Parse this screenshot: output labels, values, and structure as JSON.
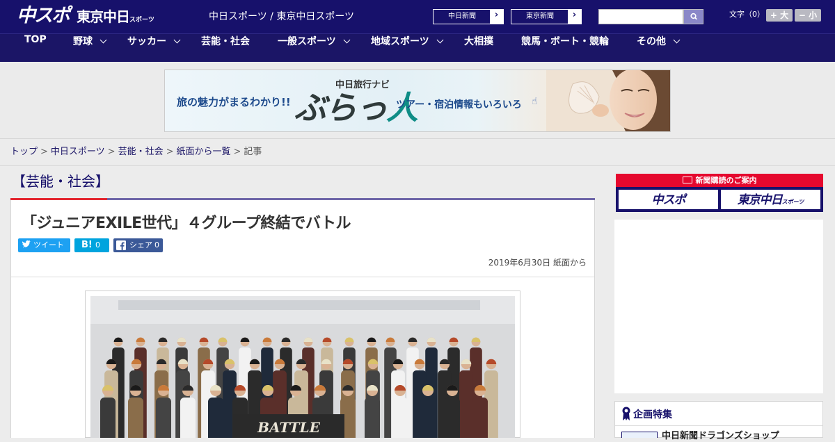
{
  "header": {
    "logo_chuspo": "中スポ",
    "logo_tokyo_main": "東京中日",
    "logo_tokyo_small": "スポーツ",
    "site_names": "中日スポーツ / 東京中日スポーツ",
    "paper_links": [
      "中日新聞",
      "東京新聞"
    ],
    "link_arrow": "›",
    "search_placeholder": "",
    "text_size_label": "文字（0）",
    "size_up_label": "+ 大",
    "size_down_label": "− 小"
  },
  "nav": {
    "items": [
      {
        "label": "TOP",
        "has_menu": false
      },
      {
        "label": "野球",
        "has_menu": true
      },
      {
        "label": "サッカー",
        "has_menu": true
      },
      {
        "label": "芸能・社会",
        "has_menu": false
      },
      {
        "label": "一般スポーツ",
        "has_menu": true
      },
      {
        "label": "地域スポーツ",
        "has_menu": true
      },
      {
        "label": "大相撲",
        "has_menu": false
      },
      {
        "label": "競馬・ボート・競輪",
        "has_menu": false
      },
      {
        "label": "その他",
        "has_menu": true
      }
    ]
  },
  "banner": {
    "catch": "旅の魅力がまるわかり!!",
    "kicker": "中日旅行ナビ",
    "title_main": "ぶらっ",
    "title_accent": "人",
    "sub": "ツアー・宿泊情報もいろいろ",
    "hand_icon": "☝"
  },
  "breadcrumb": {
    "items": [
      "トップ",
      "中日スポーツ",
      "芸能・社会",
      "紙面から一覧"
    ],
    "current": "記事",
    "separator": ">"
  },
  "article": {
    "category": "【芸能・社会】",
    "headline": "「ジュニアEXILE世代」４グループ終結でバトル",
    "share": {
      "tweet_label": "ツイート",
      "hatena_label": "B!",
      "hatena_count": "0",
      "facebook_label": "シェア",
      "facebook_count": "0"
    },
    "date": "2019年6月30日 紙面から",
    "photo_sign": "BATTLE"
  },
  "sidebar": {
    "subscription_heading": "新聞購読のご案内",
    "subscription_logos": [
      "中スポ",
      "東京中日"
    ],
    "subscription_logo_small": "スポーツ",
    "feature_title": "企画特集",
    "feature_item": "中日新聞ドラゴンズショップ"
  },
  "colors": {
    "brand_navy": "#17116b",
    "accent_red": "#e3262f",
    "twitter_blue": "#1da1f2",
    "hatena_blue": "#00a4de",
    "facebook_blue": "#3b5998"
  }
}
